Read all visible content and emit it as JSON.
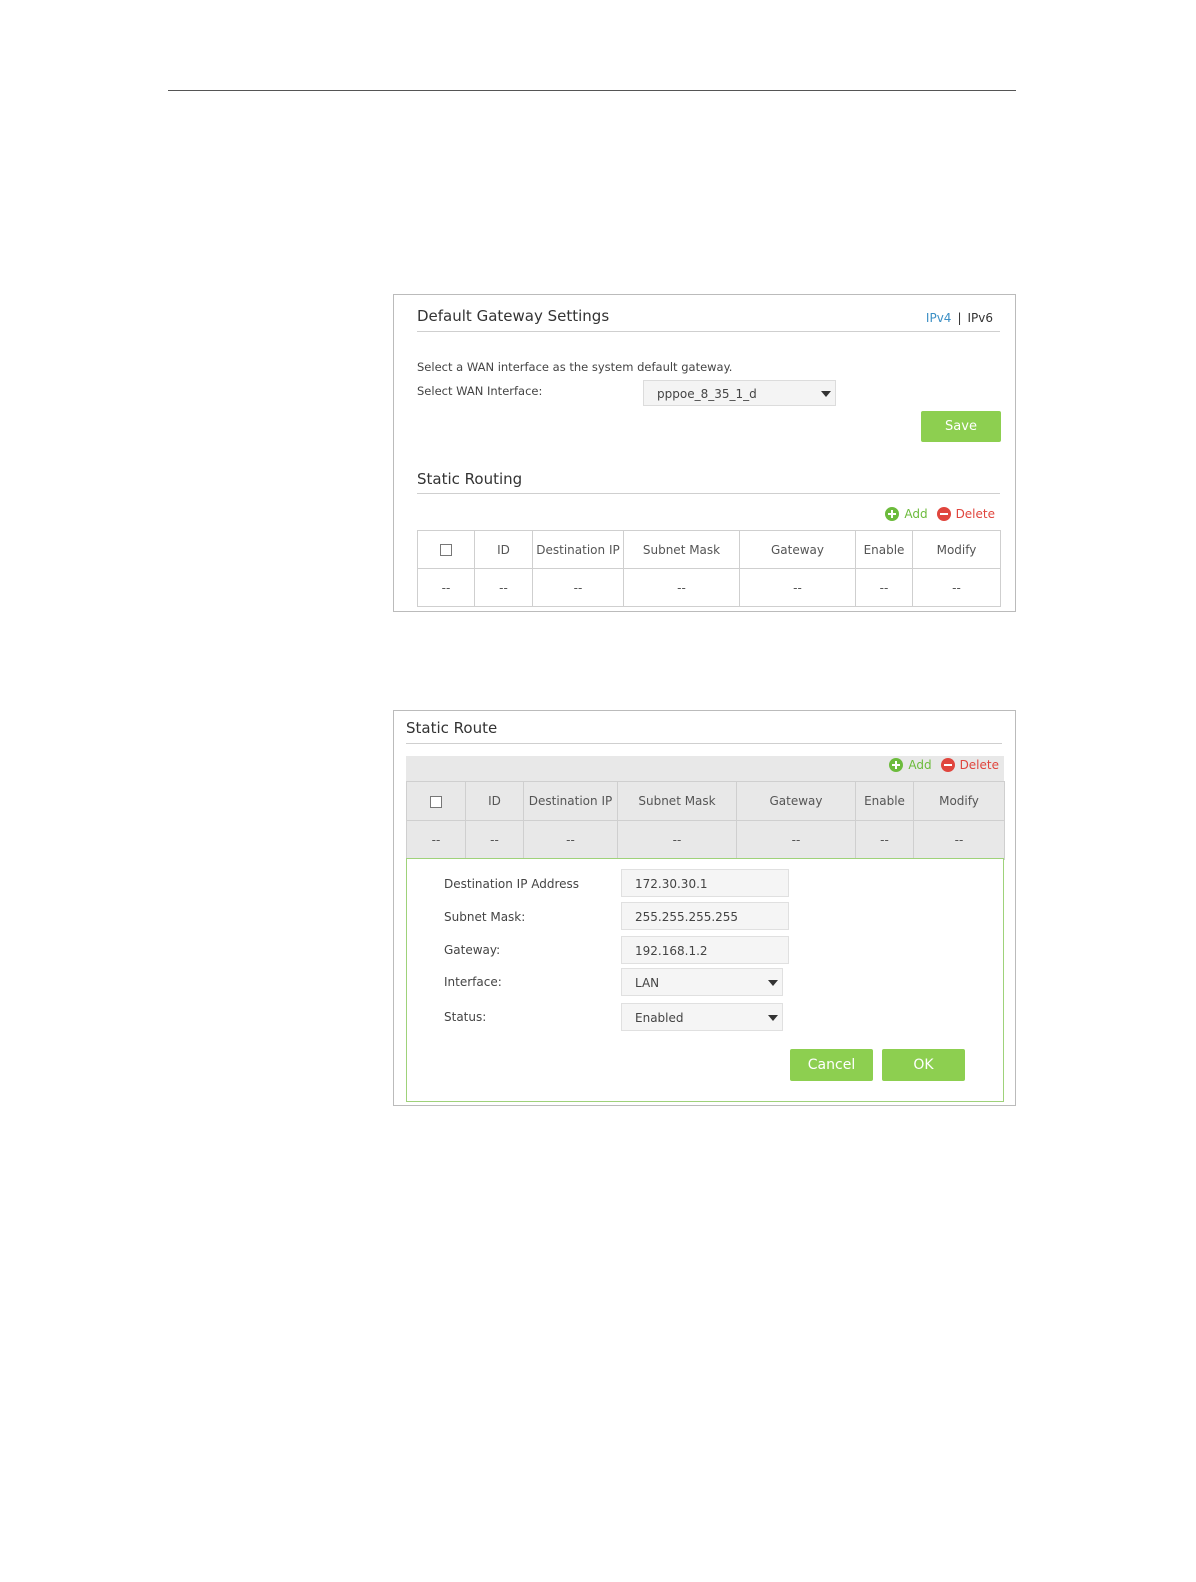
{
  "gateway_panel": {
    "title": "Default Gateway Settings",
    "links": {
      "ipv4": "IPv4",
      "separator": "|",
      "ipv6": "IPv6"
    },
    "description": "Select a WAN interface as the system default gateway.",
    "wan_label": "Select WAN Interface:",
    "wan_value": "pppoe_8_35_1_d",
    "save_label": "Save",
    "routing_title": "Static Routing",
    "add_label": "Add",
    "delete_label": "Delete",
    "columns": [
      "ID",
      "Destination IP",
      "Subnet Mask",
      "Gateway",
      "Enable",
      "Modify"
    ],
    "row": [
      "--",
      "--",
      "--",
      "--",
      "--",
      "--",
      "--"
    ]
  },
  "route_panel": {
    "title": "Static Route",
    "add_label": "Add",
    "delete_label": "Delete",
    "columns": [
      "ID",
      "Destination IP",
      "Subnet Mask",
      "Gateway",
      "Enable",
      "Modify"
    ],
    "row": [
      "--",
      "--",
      "--",
      "--",
      "--",
      "--",
      "--"
    ],
    "form": {
      "dest_label": "Destination IP Address",
      "dest_value": "172.30.30.1",
      "mask_label": "Subnet Mask:",
      "mask_value": "255.255.255.255",
      "gateway_label": "Gateway:",
      "gateway_value": "192.168.1.2",
      "interface_label": "Interface:",
      "interface_value": "LAN",
      "status_label": "Status:",
      "status_value": "Enabled",
      "cancel_label": "Cancel",
      "ok_label": "OK"
    }
  },
  "colors": {
    "accent_green": "#8dcf50",
    "add_green": "#6cbb3c",
    "delete_red": "#e0453d",
    "link_blue": "#3b8fc5"
  }
}
